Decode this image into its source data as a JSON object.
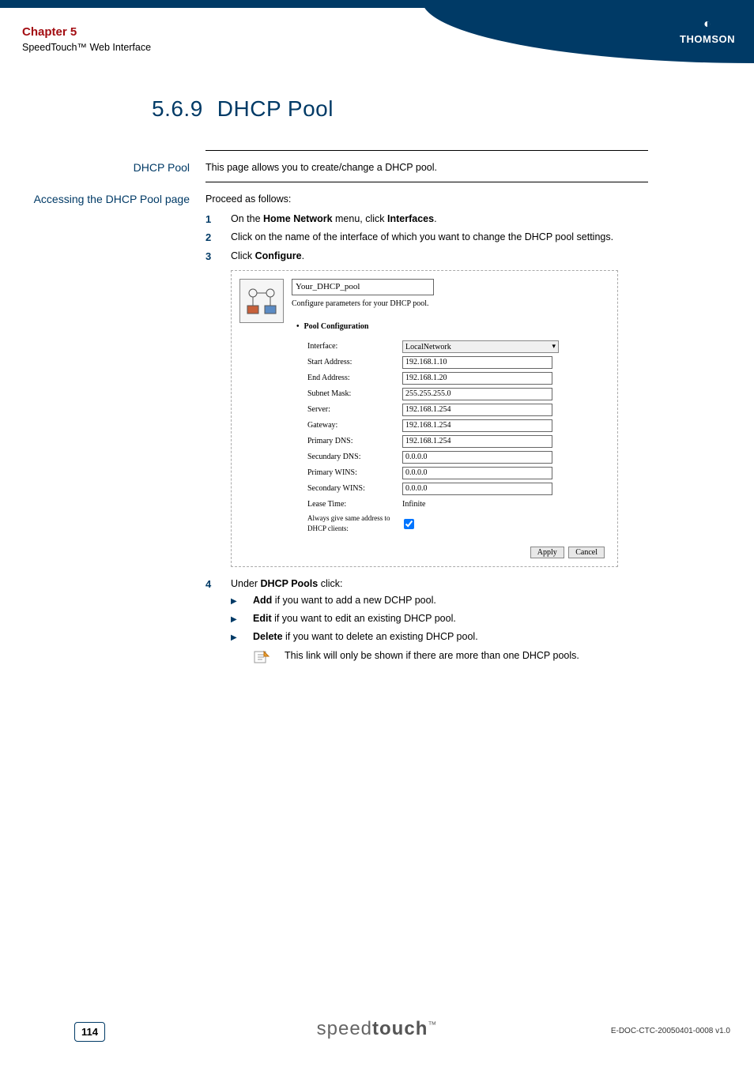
{
  "header": {
    "chapter": "Chapter 5",
    "subtitle": "SpeedTouch™ Web Interface",
    "brand": "THOMSON"
  },
  "title": {
    "number": "5.6.9",
    "text": "DHCP Pool"
  },
  "sections": [
    {
      "label": "DHCP Pool",
      "intro": "This page allows you to create/change a DHCP pool."
    },
    {
      "label": "Accessing the DHCP Pool page",
      "intro": "Proceed as follows:",
      "steps": [
        {
          "n": "1",
          "pre": "On the ",
          "b1": "Home Network",
          "mid": " menu, click ",
          "b2": "Interfaces",
          "post": "."
        },
        {
          "n": "2",
          "text": "Click on the name of the interface of which you want to change the DHCP pool settings."
        },
        {
          "n": "3",
          "pre": "Click ",
          "b1": "Configure",
          "post": "."
        }
      ],
      "screenshot": {
        "pool_name": "Your_DHCP_pool",
        "pool_desc": "Configure parameters for your DHCP pool.",
        "config_head": "Pool Configuration",
        "rows": [
          {
            "label": "Interface:",
            "type": "select",
            "value": "LocalNetwork"
          },
          {
            "label": "Start Address:",
            "type": "input",
            "value": "192.168.1.10"
          },
          {
            "label": "End Address:",
            "type": "input",
            "value": "192.168.1.20"
          },
          {
            "label": "Subnet Mask:",
            "type": "input",
            "value": "255.255.255.0"
          },
          {
            "label": "Server:",
            "type": "input",
            "value": "192.168.1.254"
          },
          {
            "label": "Gateway:",
            "type": "input",
            "value": "192.168.1.254"
          },
          {
            "label": "Primary DNS:",
            "type": "input",
            "value": "192.168.1.254"
          },
          {
            "label": "Secundary DNS:",
            "type": "input",
            "value": "0.0.0.0"
          },
          {
            "label": "Primary WINS:",
            "type": "input",
            "value": "0.0.0.0"
          },
          {
            "label": "Secondary WINS:",
            "type": "input",
            "value": "0.0.0.0"
          },
          {
            "label": "Lease Time:",
            "type": "text",
            "value": "Infinite"
          },
          {
            "label": "Always give same address to DHCP clients:",
            "type": "check",
            "value": true
          }
        ],
        "buttons": {
          "apply": "Apply",
          "cancel": "Cancel"
        }
      },
      "step4": {
        "n": "4",
        "pre": "Under ",
        "b1": "DHCP Pools",
        "post": " click:",
        "subs": [
          {
            "b": "Add",
            "rest": " if you want to add a new DCHP pool."
          },
          {
            "b": "Edit",
            "rest": " if you want to edit an existing DHCP pool."
          },
          {
            "b": "Delete",
            "rest": " if you want to delete an existing DHCP pool."
          }
        ],
        "note": "This link will only be shown if there are more than one DHCP pools."
      }
    }
  ],
  "footer": {
    "page": "114",
    "brand_light": "speed",
    "brand_bold": "touch",
    "tm": "™",
    "docid": "E-DOC-CTC-20050401-0008 v1.0"
  }
}
